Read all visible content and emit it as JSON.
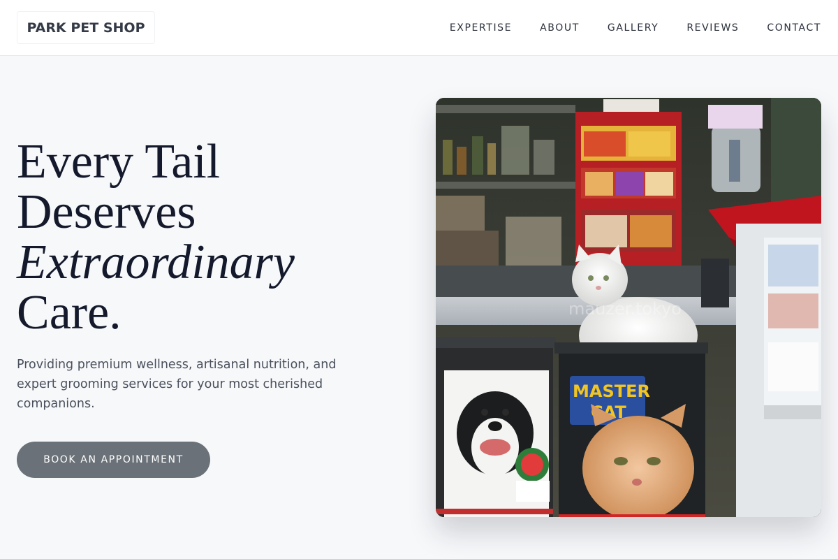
{
  "header": {
    "logo": "PARK PET SHOP",
    "nav": [
      "EXPERTISE",
      "ABOUT",
      "GALLERY",
      "REVIEWS",
      "CONTACT"
    ]
  },
  "hero": {
    "title_line1": "Every Tail",
    "title_line2": "Deserves",
    "title_em": "Extraordinary",
    "title_line4": "Care.",
    "subtitle": "Providing premium wellness, artisanal nutrition, and expert grooming services for your most cherished companions.",
    "cta_label": "BOOK AN APPOINTMENT"
  },
  "image": {
    "bag_brand_line1": "MASTER",
    "bag_brand_line2": "CAT",
    "watermark": "mauzer.tokyo"
  },
  "colors": {
    "page_bg": "#f7f8fa",
    "title": "#141a2c",
    "cta_bg": "#6a7178",
    "bag_yellow": "#f2c521",
    "bag_blue": "#2a4f9e"
  },
  "icons": [
    "photo-image"
  ]
}
